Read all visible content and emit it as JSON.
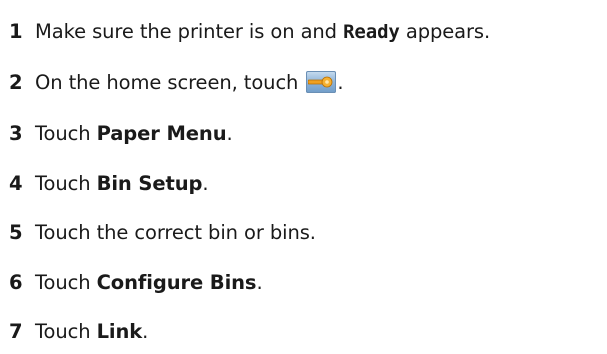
{
  "steps": [
    {
      "number": "1",
      "text_before": "Make sure the printer is on and ",
      "code": "Ready",
      "text_after": " appears."
    },
    {
      "number": "2",
      "text_before": "On the home screen, touch ",
      "icon": "settings-key-icon",
      "text_after": "."
    },
    {
      "number": "3",
      "text_before": "Touch ",
      "bold": "Paper Menu",
      "text_after": "."
    },
    {
      "number": "4",
      "text_before": "Touch ",
      "bold": "Bin Setup",
      "text_after": "."
    },
    {
      "number": "5",
      "text_before": "Touch the correct bin or bins."
    },
    {
      "number": "6",
      "text_before": "Touch ",
      "bold": "Configure Bins",
      "text_after": "."
    },
    {
      "number": "7",
      "text_before": "Touch ",
      "bold": "Link",
      "text_after": "."
    }
  ],
  "colors": {
    "text": "#1a1a1a",
    "icon_bg": "#8fb4d8",
    "icon_key": "#f0a020"
  }
}
